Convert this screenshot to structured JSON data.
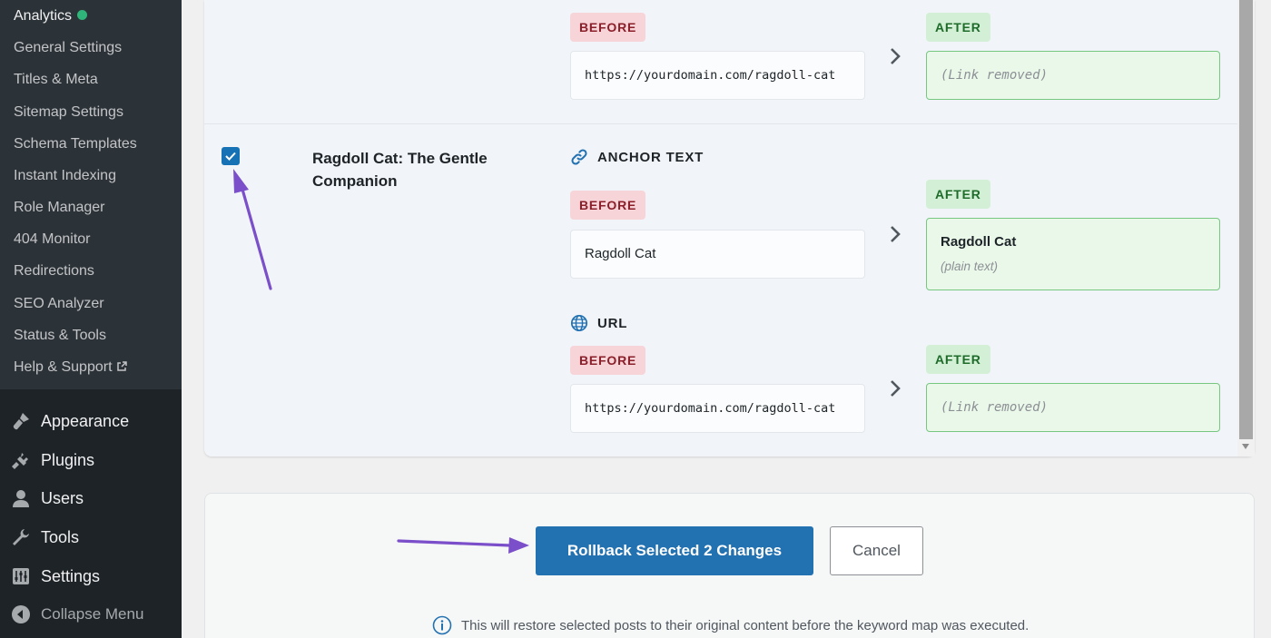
{
  "sidebar": {
    "submenu": [
      {
        "label": "Analytics",
        "status_dot_color": "#2fb47a"
      },
      {
        "label": "General Settings"
      },
      {
        "label": "Titles & Meta"
      },
      {
        "label": "Sitemap Settings"
      },
      {
        "label": "Schema Templates"
      },
      {
        "label": "Instant Indexing"
      },
      {
        "label": "Role Manager"
      },
      {
        "label": "404 Monitor"
      },
      {
        "label": "Redirections"
      },
      {
        "label": "SEO Analyzer"
      },
      {
        "label": "Status & Tools"
      },
      {
        "label": "Help & Support",
        "icon": "external-link-icon"
      }
    ],
    "menu": [
      {
        "label": "Appearance",
        "icon": "paintbrush-icon"
      },
      {
        "label": "Plugins",
        "icon": "plug-icon"
      },
      {
        "label": "Users",
        "icon": "user-icon"
      },
      {
        "label": "Tools",
        "icon": "wrench-icon"
      },
      {
        "label": "Settings",
        "icon": "sliders-icon"
      },
      {
        "label": "Collapse Menu",
        "icon": "collapse-icon"
      }
    ]
  },
  "rows": [
    {
      "url_section": {
        "before_label": "BEFORE",
        "before_value": "https://yourdomain.com/ragdoll-cat",
        "after_label": "AFTER",
        "after_value": "(Link removed)"
      }
    },
    {
      "selected": true,
      "post_title": "Ragdoll Cat: The Gentle Companion",
      "anchor_section": {
        "heading": "ANCHOR TEXT",
        "icon": "link-icon",
        "before_label": "BEFORE",
        "before_value": "Ragdoll Cat",
        "after_label": "AFTER",
        "after_value": "Ragdoll Cat",
        "after_note": "(plain text)"
      },
      "url_section": {
        "heading": "URL",
        "icon": "globe-icon",
        "before_label": "BEFORE",
        "before_value": "https://yourdomain.com/ragdoll-cat",
        "after_label": "AFTER",
        "after_value": "(Link removed)"
      }
    }
  ],
  "footer": {
    "rollback_label": "Rollback Selected 2 Changes",
    "cancel_label": "Cancel",
    "info_text": "This will restore selected posts to their original content before the keyword map was executed."
  },
  "colors": {
    "accent": "#2271b1",
    "annotation_arrow": "#7b4fc9",
    "before_badge": "#f7d4d8",
    "after_badge": "#d3f0d6",
    "after_border": "#77c781"
  }
}
